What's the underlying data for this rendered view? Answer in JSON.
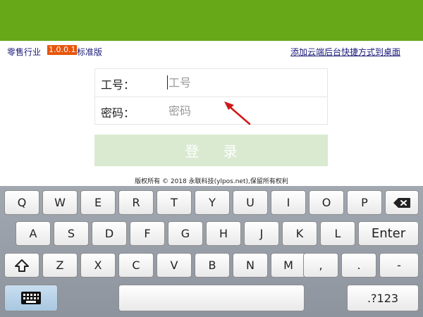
{
  "header": {
    "industry": "零售行业",
    "version": "1.0.0.1",
    "edition": "标准版",
    "shortcut_link": "添加云端后台快捷方式到桌面"
  },
  "form": {
    "employee_label": "工号：",
    "employee_placeholder": "工号",
    "employee_value": "",
    "password_label": "密码：",
    "password_placeholder": "密码",
    "password_value": "",
    "login_label": "登 录"
  },
  "footer": {
    "copyright": "版权所有 © 2018 永联科技(ylpos.net),保留所有权利"
  },
  "keyboard": {
    "row1": [
      "Q",
      "W",
      "E",
      "R",
      "T",
      "Y",
      "U",
      "I",
      "O",
      "P"
    ],
    "row2": [
      "A",
      "S",
      "D",
      "F",
      "G",
      "H",
      "J",
      "K",
      "L"
    ],
    "row3": [
      "Z",
      "X",
      "C",
      "V",
      "B",
      "N",
      "M",
      ",",
      "."
    ],
    "enter_label": "Enter",
    "dash_label": "-",
    "symbols_label": ".?123",
    "space_label": ""
  },
  "colors": {
    "header_green": "#66a818",
    "version_badge": "#e8550a",
    "login_button": "#d9ead1"
  }
}
